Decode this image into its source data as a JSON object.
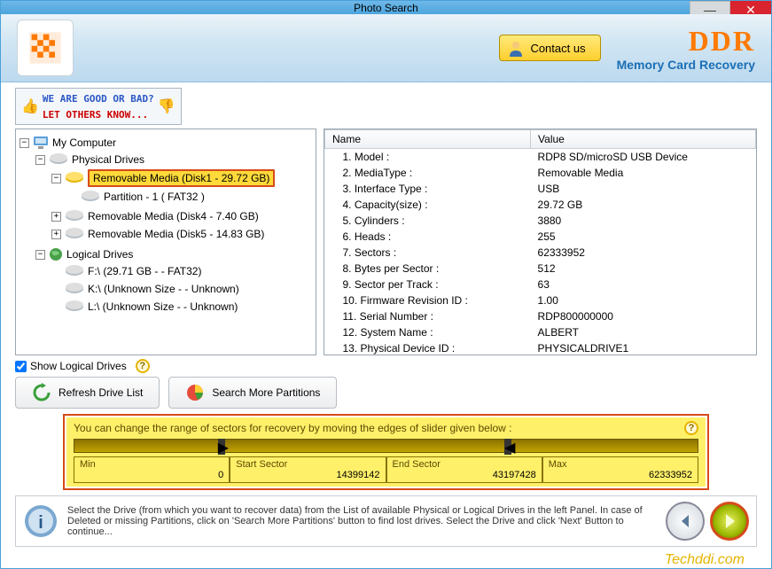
{
  "window": {
    "title": "Photo Search"
  },
  "banner": {
    "contact_label": "Contact us",
    "brand": "DDR",
    "brand_sub": "Memory Card Recovery"
  },
  "ratebar": {
    "line1": "WE ARE GOOD OR BAD?",
    "line2": "LET OTHERS KNOW..."
  },
  "tree": {
    "root": "My Computer",
    "physical": "Physical Drives",
    "disk1": "Removable Media (Disk1 - 29.72 GB)",
    "disk1_part": "Partition - 1 ( FAT32 )",
    "disk4": "Removable Media (Disk4 - 7.40 GB)",
    "disk5": "Removable Media (Disk5 - 14.83 GB)",
    "logical": "Logical Drives",
    "drive_f": "F:\\ (29.71 GB  -  - FAT32)",
    "drive_k": "K:\\ (Unknown Size  -  - Unknown)",
    "drive_l": "L:\\ (Unknown Size  -  - Unknown)"
  },
  "table": {
    "col_name": "Name",
    "col_value": "Value",
    "rows": [
      {
        "name": "1. Model :",
        "value": "RDP8 SD/microSD USB Device"
      },
      {
        "name": "2. MediaType :",
        "value": "Removable Media"
      },
      {
        "name": "3. Interface Type :",
        "value": "USB"
      },
      {
        "name": "4. Capacity(size) :",
        "value": "29.72 GB"
      },
      {
        "name": "5. Cylinders :",
        "value": "3880"
      },
      {
        "name": "6. Heads :",
        "value": "255"
      },
      {
        "name": "7. Sectors :",
        "value": "62333952"
      },
      {
        "name": "8. Bytes per Sector :",
        "value": "512"
      },
      {
        "name": "9. Sector per Track :",
        "value": "63"
      },
      {
        "name": "10. Firmware Revision ID :",
        "value": "1.00"
      },
      {
        "name": "11. Serial Number :",
        "value": "RDP800000000"
      },
      {
        "name": "12. System Name :",
        "value": "ALBERT"
      },
      {
        "name": "13. Physical Device ID :",
        "value": "PHYSICALDRIVE1"
      }
    ]
  },
  "options": {
    "show_logical": "Show Logical Drives",
    "refresh": "Refresh Drive List",
    "search_more": "Search More Partitions"
  },
  "slider": {
    "msg": "You can change the range of sectors for recovery by moving the edges of slider given below :",
    "min_label": "Min",
    "min_val": "0",
    "start_label": "Start Sector",
    "start_val": "14399142",
    "end_label": "End Sector",
    "end_val": "43197428",
    "max_label": "Max",
    "max_val": "62333952"
  },
  "footer": {
    "text": "Select the Drive (from which you want to recover data) from the List of available Physical or Logical Drives in the left Panel. In case of Deleted or missing Partitions, click on 'Search More Partitions' button to find lost drives. Select the Drive and click 'Next' Button to continue..."
  },
  "watermark": "Techddi.com"
}
